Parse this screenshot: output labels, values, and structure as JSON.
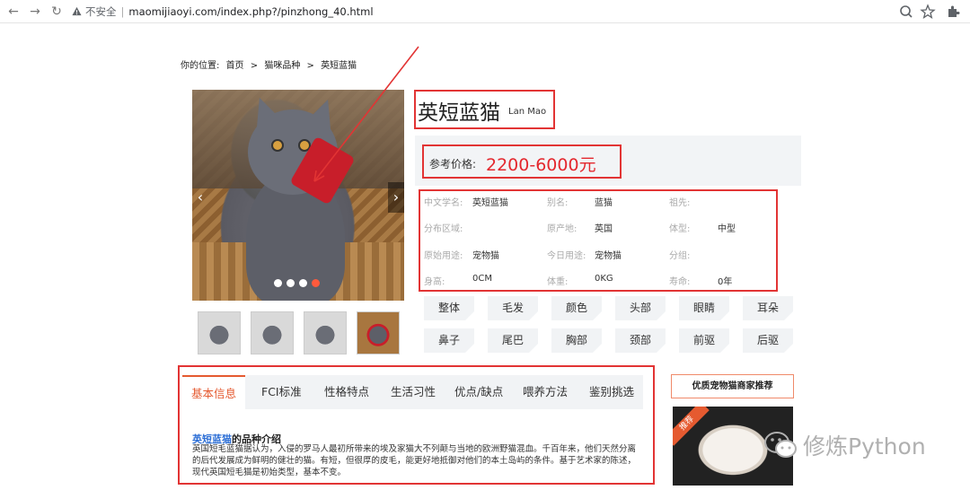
{
  "browser": {
    "security_label": "不安全",
    "url": "maomijiaoyi.com/index.php?/pinzhong_40.html"
  },
  "breadcrumb": {
    "prefix": "你的位置:",
    "items": [
      "首页",
      ">",
      "猫咪品种",
      ">",
      "英短蓝猫"
    ]
  },
  "breed": {
    "name": "英短蓝猫",
    "name_en": "Lan Mao",
    "price_label": "参考价格:",
    "price_value": "2200-6000元"
  },
  "info": [
    [
      {
        "k": "中文学名:",
        "v": "英短蓝猫"
      },
      {
        "k": "别名:",
        "v": "蓝猫"
      },
      {
        "k": "祖先:",
        "v": ""
      }
    ],
    [
      {
        "k": "分布区域:",
        "v": ""
      },
      {
        "k": "原产地:",
        "v": "英国"
      },
      {
        "k": "体型:",
        "v": "中型"
      }
    ],
    [
      {
        "k": "原始用途:",
        "v": "宠物猫"
      },
      {
        "k": "今日用途:",
        "v": "宠物猫"
      },
      {
        "k": "分组:",
        "v": ""
      }
    ],
    [
      {
        "k": "身高:",
        "v": "0CM"
      },
      {
        "k": "体重:",
        "v": "0KG"
      },
      {
        "k": "寿命:",
        "v": "0年"
      }
    ]
  ],
  "tags": [
    "整体",
    "毛发",
    "颜色",
    "头部",
    "眼睛",
    "耳朵",
    "鼻子",
    "尾巴",
    "胸部",
    "颈部",
    "前驱",
    "后驱"
  ],
  "tabs": [
    "基本信息",
    "FCI标准",
    "性格特点",
    "生活习性",
    "优点/缺点",
    "喂养方法",
    "鉴别挑选"
  ],
  "active_tab": "基本信息",
  "intro": {
    "highlight": "英短蓝猫",
    "title_suffix": "的品种介绍",
    "text": "英国短毛蓝猫据认为，入侵的罗马人最初所带来的埃及家猫大不列颠与当地的欧洲野猫混血。千百年来，他们天然分离的后代发展成为鲜明的健壮的猫。有短，但很厚的皮毛，能更好地抵御对他们的本土岛屿的条件。基于艺术家的陈述，现代英国短毛猫是初始类型，基本不变。"
  },
  "recommend": {
    "title": "优质宠物猫商家推荐",
    "badge": "推荐"
  },
  "watermark": "修炼Python",
  "colors": {
    "accent": "#e55a30",
    "price": "#e4282e",
    "annotation": "#e23434",
    "link": "#2d6fd6"
  }
}
